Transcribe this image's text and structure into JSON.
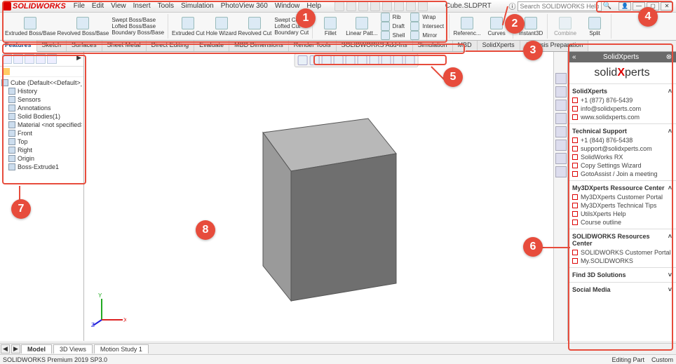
{
  "app": {
    "name": "SOLIDWORKS",
    "doc": "Cube.SLDPRT"
  },
  "menu": [
    "File",
    "Edit",
    "View",
    "Insert",
    "Tools",
    "Simulation",
    "PhotoView 360",
    "Window",
    "Help"
  ],
  "search": {
    "placeholder": "Search SOLIDWORKS Help"
  },
  "ribbon": {
    "extrudedBoss": "Extruded Boss/Base",
    "revolvedBoss": "Revolved Boss/Base",
    "sweptBoss": "Swept Boss/Base",
    "loftedBoss": "Lofted Boss/Base",
    "boundaryBoss": "Boundary Boss/Base",
    "extrudedCut": "Extruded Cut",
    "holeWizard": "Hole Wizard",
    "revolvedCut": "Revolved Cut",
    "sweptCut": "Swept Cut",
    "loftedCut": "Lofted Cut",
    "boundaryCut": "Boundary Cut",
    "fillet": "Fillet",
    "linearPattern": "Linear Patt...",
    "rib": "Rib",
    "draft": "Draft",
    "shell": "Shell",
    "wrap": "Wrap",
    "intersect": "Intersect",
    "mirror": "Mirror",
    "referenc": "Referenc...",
    "curves": "Curves",
    "instant3d": "Instant3D",
    "combine": "Combine",
    "split": "Split"
  },
  "tabs": [
    "Features",
    "Sketch",
    "Surfaces",
    "Sheet Metal",
    "Direct Editing",
    "Evaluate",
    "MBD Dimensions",
    "Render Tools",
    "SOLIDWORKS Add-Ins",
    "Simulation",
    "MBD",
    "SolidXperts",
    "Analysis Preparation"
  ],
  "tree": {
    "root": "Cube  (Default<<Default>_Pho...",
    "history": "History",
    "sensors": "Sensors",
    "annotations": "Annotations",
    "solidBodies": "Solid Bodies(1)",
    "material": "Material <not specified>",
    "front": "Front",
    "top": "Top",
    "right": "Right",
    "origin": "Origin",
    "bossExtrude": "Boss-Extrude1"
  },
  "taskpane": {
    "title": "SolidXperts",
    "logo_a": "solid",
    "logo_b": "perts",
    "sec1": {
      "title": "SolidXperts",
      "items": [
        "+1 (877) 876-5439",
        "info@solidxperts.com",
        "www.solidxperts.com"
      ]
    },
    "sec2": {
      "title": "Technical Support",
      "items": [
        "+1 (844) 876-5438",
        "support@solidxperts.com",
        "SolidWorks RX",
        "Copy Settings Wizard",
        "GotoAssist / Join a meeting"
      ]
    },
    "sec3": {
      "title": "My3DXperts Ressource Center",
      "items": [
        "My3DXperts Customer Portal",
        "My3DXperts Technical Tips",
        "UtilsXperts Help",
        "Course outline"
      ]
    },
    "sec4": {
      "title": "SOLIDWORKS Resources Center",
      "items": [
        "SOLIDWORKS Customer Portal",
        "My.SOLIDWORKS"
      ]
    },
    "sec5": {
      "title": "Find 3D Solutions"
    },
    "sec6": {
      "title": "Social Media"
    }
  },
  "viewtabs": [
    "Model",
    "3D Views",
    "Motion Study 1"
  ],
  "status": {
    "left": "SOLIDWORKS Premium 2019 SP3.0",
    "r1": "Editing Part",
    "r2": "Custom"
  },
  "callouts": [
    "1",
    "2",
    "3",
    "4",
    "5",
    "6",
    "7",
    "8"
  ]
}
